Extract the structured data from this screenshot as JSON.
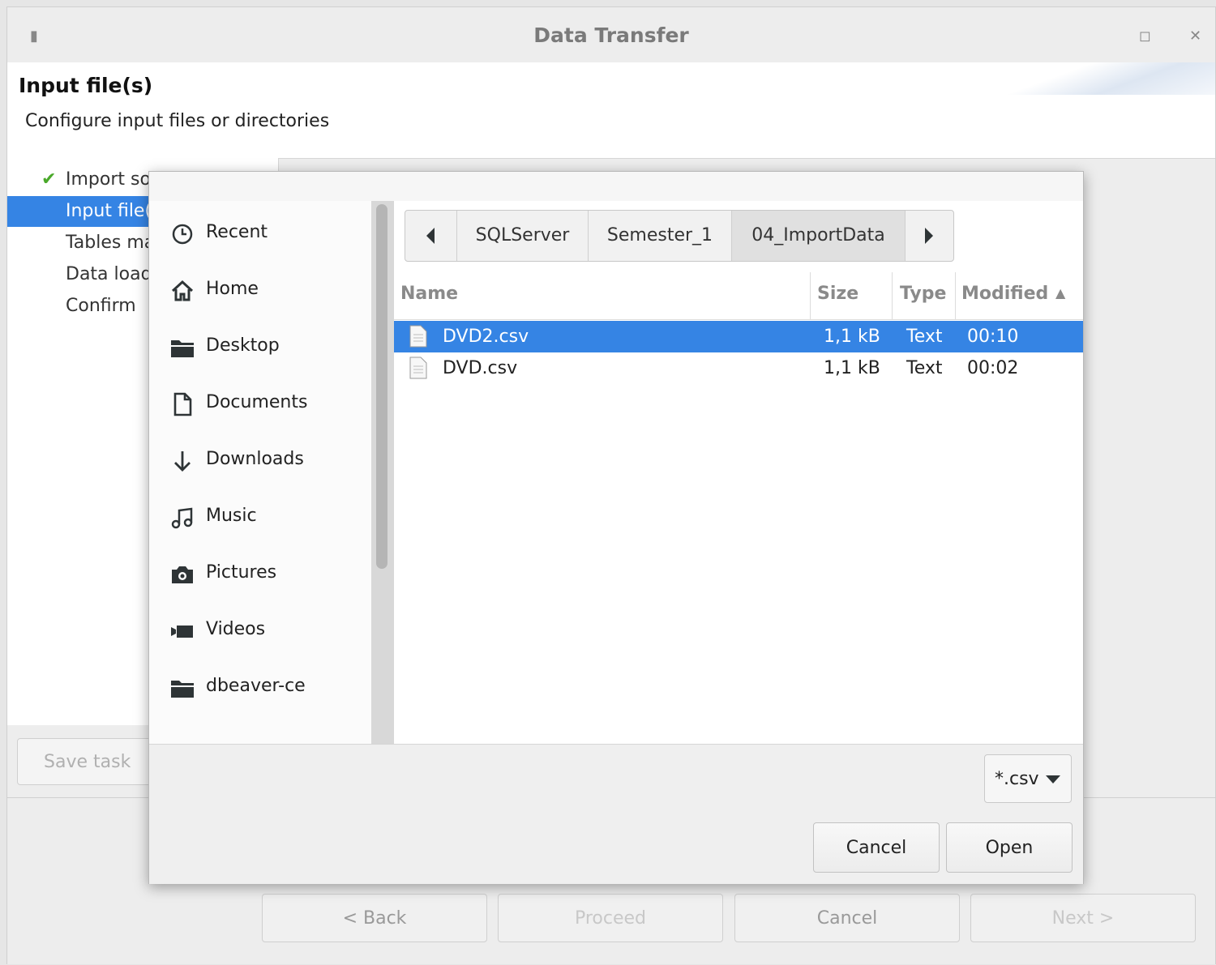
{
  "window": {
    "title": "Data Transfer",
    "header_title": "Input file(s)",
    "header_subtitle": "Configure input files or directories"
  },
  "wizard_nav": {
    "items": [
      {
        "label": "Import source",
        "done": true
      },
      {
        "label": "Input file(s)",
        "selected": true
      },
      {
        "label": "Tables mapping"
      },
      {
        "label": "Data load settings"
      },
      {
        "label": "Confirm"
      }
    ],
    "save_task_label": "Save task"
  },
  "wizard_buttons": {
    "back": "< Back",
    "proceed": "Proceed",
    "cancel": "Cancel",
    "next": "Next >"
  },
  "file_dialog": {
    "places": [
      {
        "label": "Recent",
        "icon": "clock-icon"
      },
      {
        "label": "Home",
        "icon": "home-icon"
      },
      {
        "label": "Desktop",
        "icon": "folder-icon"
      },
      {
        "label": "Documents",
        "icon": "document-icon"
      },
      {
        "label": "Downloads",
        "icon": "download-arrow-icon"
      },
      {
        "label": "Music",
        "icon": "music-note-icon"
      },
      {
        "label": "Pictures",
        "icon": "camera-icon"
      },
      {
        "label": "Videos",
        "icon": "video-camera-icon"
      },
      {
        "label": "dbeaver-ce",
        "icon": "folder-icon"
      }
    ],
    "path_segments": [
      "SQLServer",
      "Semester_1",
      "04_ImportData"
    ],
    "active_segment": "04_ImportData",
    "columns": {
      "name": "Name",
      "size": "Size",
      "type": "Type",
      "modified": "Modified"
    },
    "sort_indicator": "▲",
    "files": [
      {
        "name": "DVD2.csv",
        "size": "1,1 kB",
        "type": "Text",
        "modified": "00:10",
        "selected": true
      },
      {
        "name": "DVD.csv",
        "size": "1,1 kB",
        "type": "Text",
        "modified": "00:02",
        "selected": false
      }
    ],
    "filter_value": "*.csv",
    "cancel_label": "Cancel",
    "open_label": "Open"
  },
  "colors": {
    "selection": "#3584e4",
    "check": "#4aa92a"
  }
}
